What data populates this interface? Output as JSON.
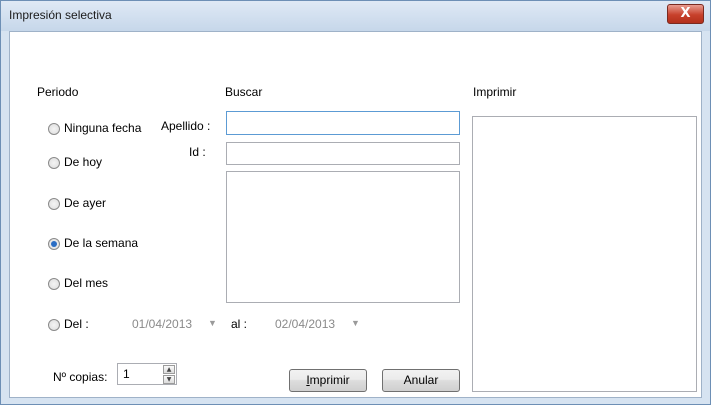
{
  "window": {
    "title": "Impresión selectiva",
    "close_label": "X"
  },
  "periodo": {
    "heading": "Periodo",
    "options": [
      {
        "label": "Ninguna fecha",
        "checked": false
      },
      {
        "label": "De hoy",
        "checked": false
      },
      {
        "label": "De ayer",
        "checked": false
      },
      {
        "label": "De la semana",
        "checked": true
      },
      {
        "label": "Del mes",
        "checked": false
      },
      {
        "label": "Del :",
        "checked": false
      }
    ],
    "date_from": "01/04/2013",
    "date_to_label": "al :",
    "date_to": "02/04/2013"
  },
  "buscar": {
    "heading": "Buscar",
    "apellido_label": "Apellido :",
    "apellido_value": "",
    "id_label": "Id :",
    "id_value": ""
  },
  "imprimir_panel": {
    "heading": "Imprimir"
  },
  "copias": {
    "label": "Nº copias:",
    "value": "1"
  },
  "buttons": {
    "print": "Imprimir",
    "cancel": "Anular"
  },
  "icons": {
    "radio": "radio-icon",
    "dropdown": "dropdown-arrow-icon",
    "spinner": "spinner-icon",
    "close": "close-icon"
  }
}
